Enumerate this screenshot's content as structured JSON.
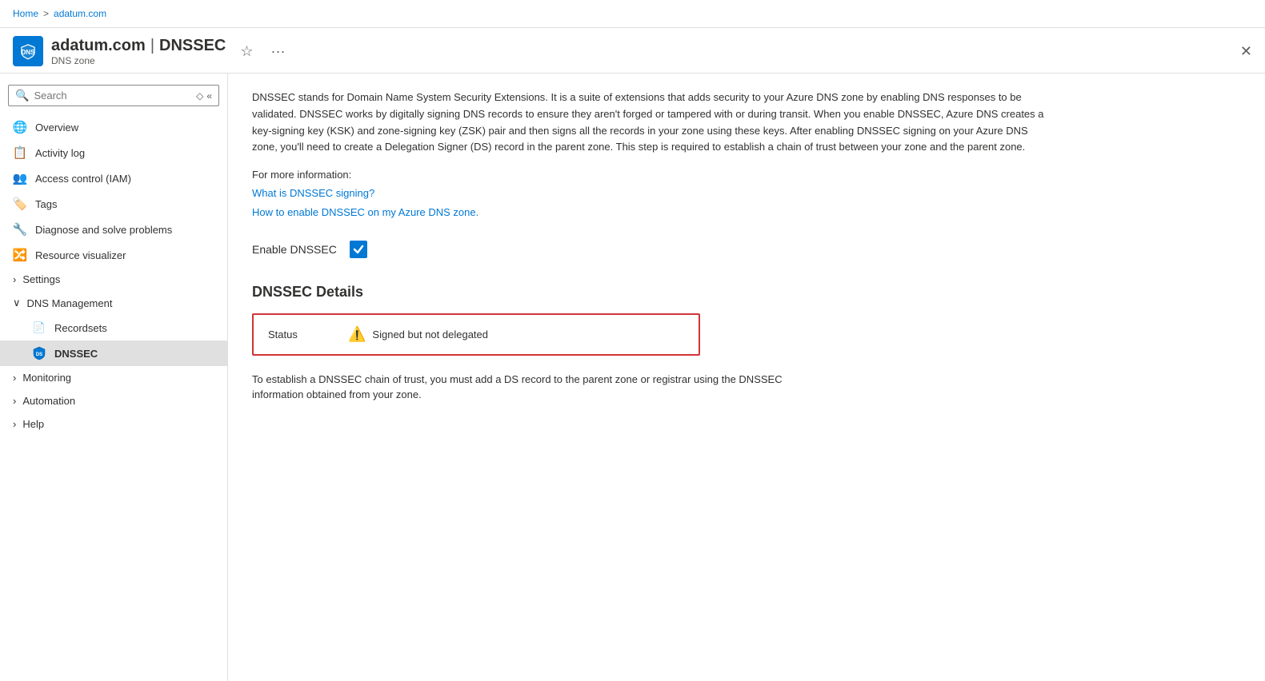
{
  "breadcrumb": {
    "home": "Home",
    "separator": ">",
    "current": "adatum.com"
  },
  "header": {
    "resource_name": "adatum.com",
    "separator": " | ",
    "page_name": "DNSSEC",
    "resource_type": "DNS zone",
    "star_label": "☆",
    "more_label": "···",
    "close_label": "✕"
  },
  "sidebar": {
    "search_placeholder": "Search",
    "items": [
      {
        "id": "overview",
        "label": "Overview",
        "icon": "globe",
        "indent": false,
        "expandable": false
      },
      {
        "id": "activity-log",
        "label": "Activity log",
        "icon": "doc",
        "indent": false,
        "expandable": false
      },
      {
        "id": "access-control",
        "label": "Access control (IAM)",
        "icon": "users",
        "indent": false,
        "expandable": false
      },
      {
        "id": "tags",
        "label": "Tags",
        "icon": "tag",
        "indent": false,
        "expandable": false
      },
      {
        "id": "diagnose",
        "label": "Diagnose and solve problems",
        "icon": "wrench",
        "indent": false,
        "expandable": false
      },
      {
        "id": "resource-visualizer",
        "label": "Resource visualizer",
        "icon": "diagram",
        "indent": false,
        "expandable": false
      },
      {
        "id": "settings",
        "label": "Settings",
        "icon": "",
        "indent": false,
        "expandable": true,
        "expanded": false
      },
      {
        "id": "dns-management",
        "label": "DNS Management",
        "icon": "",
        "indent": false,
        "expandable": true,
        "expanded": true
      },
      {
        "id": "recordsets",
        "label": "Recordsets",
        "icon": "dns-small",
        "indent": true,
        "expandable": false
      },
      {
        "id": "dnssec",
        "label": "DNSSEC",
        "icon": "shield",
        "indent": true,
        "expandable": false,
        "active": true
      },
      {
        "id": "monitoring",
        "label": "Monitoring",
        "icon": "",
        "indent": false,
        "expandable": true,
        "expanded": false
      },
      {
        "id": "automation",
        "label": "Automation",
        "icon": "",
        "indent": false,
        "expandable": true,
        "expanded": false
      },
      {
        "id": "help",
        "label": "Help",
        "icon": "",
        "indent": false,
        "expandable": true,
        "expanded": false
      }
    ]
  },
  "content": {
    "description": "DNSSEC stands for Domain Name System Security Extensions. It is a suite of extensions that adds security to your Azure DNS zone by enabling DNS responses to be validated. DNSSEC works by digitally signing DNS records to ensure they aren't forged or tampered with or during transit. When you enable DNSSEC, Azure DNS creates a key-signing key (KSK) and zone-signing key (ZSK) pair and then signs all the records in your zone using these keys. After enabling DNSSEC signing on your Azure DNS zone, you'll need to create a Delegation Signer (DS) record in the parent zone. This step is required to establish a chain of trust between your zone and the parent zone.",
    "more_info_label": "For more information:",
    "link1": "What is DNSSEC signing?",
    "link2": "How to enable DNSSEC on my Azure DNS zone.",
    "enable_label": "Enable DNSSEC",
    "details_title": "DNSSEC Details",
    "status_label": "Status",
    "status_value": "Signed but not delegated",
    "bottom_note": "To establish a DNSSEC chain of trust, you must add a DS record to the parent zone or registrar using the DNSSEC information obtained from your zone."
  }
}
